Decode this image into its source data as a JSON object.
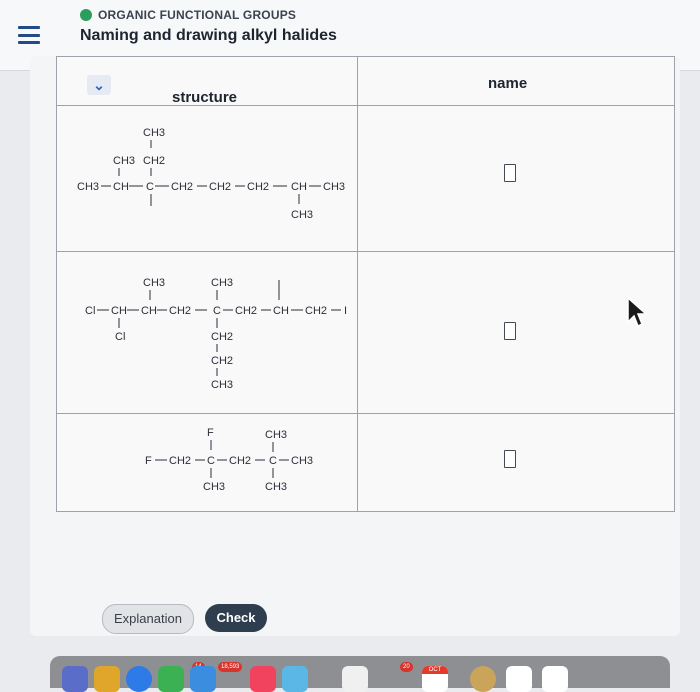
{
  "header": {
    "topic": "ORGANIC FUNCTIONAL GROUPS",
    "title": "Naming and drawing alkyl halides"
  },
  "table": {
    "col_structure": "structure",
    "col_name": "name",
    "rows": [
      {
        "labels": {
          "ch3_top": "CH3",
          "ch3_second": "CH3",
          "ch2_branch": "CH2",
          "left_ch3": "CH3",
          "ch": "CH",
          "c": "C",
          "ch2_a": "CH2",
          "ch2_b": "CH2",
          "ch2_c": "CH2",
          "ch_right": "CH",
          "ch3_end": "CH3",
          "ch3_below": "CH3"
        }
      },
      {
        "labels": {
          "ch3_a": "CH3",
          "ch3_b": "CH3",
          "cl_left": "Cl",
          "ch_a": "CH",
          "ch_b": "CH",
          "ch2_a": "CH2",
          "c": "C",
          "ch2_b": "CH2",
          "ch_c": "CH",
          "ch2_c": "CH2",
          "i": "I",
          "cl_below": "Cl",
          "ch2_d": "CH2",
          "ch2_e": "CH2",
          "ch3_bottom": "CH3"
        }
      },
      {
        "labels": {
          "f_top": "F",
          "ch3_top": "CH3",
          "f_left": "F",
          "ch2_a": "CH2",
          "c_a": "C",
          "ch2_b": "CH2",
          "c_b": "C",
          "ch3_right": "CH3",
          "ch3_below_a": "CH3",
          "ch3_below_b": "CH3"
        }
      }
    ]
  },
  "buttons": {
    "explanation": "Explanation",
    "check": "Check"
  },
  "dock": {
    "badge_mail": "14",
    "badge_count": "18,593",
    "badge_cal": "20",
    "cal_month": "OCT"
  }
}
